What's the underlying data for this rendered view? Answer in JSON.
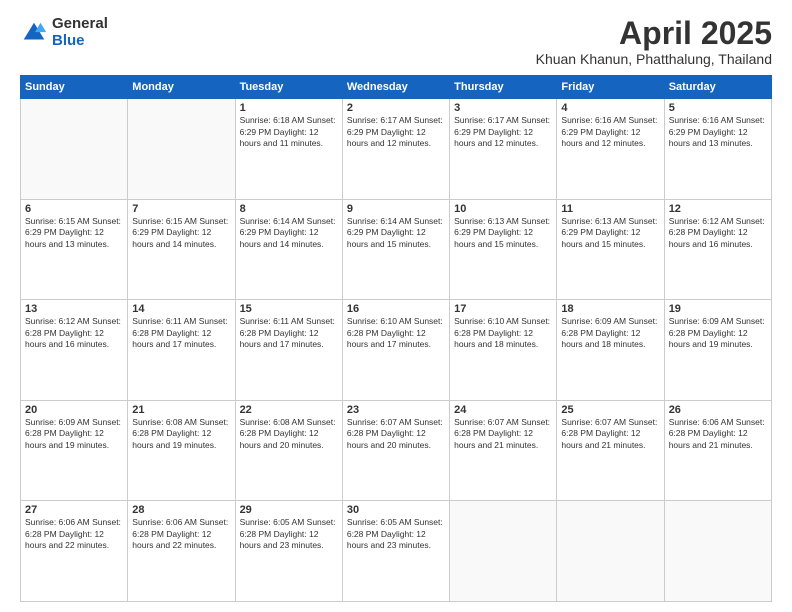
{
  "logo": {
    "general": "General",
    "blue": "Blue"
  },
  "header": {
    "month": "April 2025",
    "location": "Khuan Khanun, Phatthalung, Thailand"
  },
  "weekdays": [
    "Sunday",
    "Monday",
    "Tuesday",
    "Wednesday",
    "Thursday",
    "Friday",
    "Saturday"
  ],
  "weeks": [
    [
      {
        "day": "",
        "info": ""
      },
      {
        "day": "",
        "info": ""
      },
      {
        "day": "1",
        "info": "Sunrise: 6:18 AM\nSunset: 6:29 PM\nDaylight: 12 hours\nand 11 minutes."
      },
      {
        "day": "2",
        "info": "Sunrise: 6:17 AM\nSunset: 6:29 PM\nDaylight: 12 hours\nand 12 minutes."
      },
      {
        "day": "3",
        "info": "Sunrise: 6:17 AM\nSunset: 6:29 PM\nDaylight: 12 hours\nand 12 minutes."
      },
      {
        "day": "4",
        "info": "Sunrise: 6:16 AM\nSunset: 6:29 PM\nDaylight: 12 hours\nand 12 minutes."
      },
      {
        "day": "5",
        "info": "Sunrise: 6:16 AM\nSunset: 6:29 PM\nDaylight: 12 hours\nand 13 minutes."
      }
    ],
    [
      {
        "day": "6",
        "info": "Sunrise: 6:15 AM\nSunset: 6:29 PM\nDaylight: 12 hours\nand 13 minutes."
      },
      {
        "day": "7",
        "info": "Sunrise: 6:15 AM\nSunset: 6:29 PM\nDaylight: 12 hours\nand 14 minutes."
      },
      {
        "day": "8",
        "info": "Sunrise: 6:14 AM\nSunset: 6:29 PM\nDaylight: 12 hours\nand 14 minutes."
      },
      {
        "day": "9",
        "info": "Sunrise: 6:14 AM\nSunset: 6:29 PM\nDaylight: 12 hours\nand 15 minutes."
      },
      {
        "day": "10",
        "info": "Sunrise: 6:13 AM\nSunset: 6:29 PM\nDaylight: 12 hours\nand 15 minutes."
      },
      {
        "day": "11",
        "info": "Sunrise: 6:13 AM\nSunset: 6:29 PM\nDaylight: 12 hours\nand 15 minutes."
      },
      {
        "day": "12",
        "info": "Sunrise: 6:12 AM\nSunset: 6:28 PM\nDaylight: 12 hours\nand 16 minutes."
      }
    ],
    [
      {
        "day": "13",
        "info": "Sunrise: 6:12 AM\nSunset: 6:28 PM\nDaylight: 12 hours\nand 16 minutes."
      },
      {
        "day": "14",
        "info": "Sunrise: 6:11 AM\nSunset: 6:28 PM\nDaylight: 12 hours\nand 17 minutes."
      },
      {
        "day": "15",
        "info": "Sunrise: 6:11 AM\nSunset: 6:28 PM\nDaylight: 12 hours\nand 17 minutes."
      },
      {
        "day": "16",
        "info": "Sunrise: 6:10 AM\nSunset: 6:28 PM\nDaylight: 12 hours\nand 17 minutes."
      },
      {
        "day": "17",
        "info": "Sunrise: 6:10 AM\nSunset: 6:28 PM\nDaylight: 12 hours\nand 18 minutes."
      },
      {
        "day": "18",
        "info": "Sunrise: 6:09 AM\nSunset: 6:28 PM\nDaylight: 12 hours\nand 18 minutes."
      },
      {
        "day": "19",
        "info": "Sunrise: 6:09 AM\nSunset: 6:28 PM\nDaylight: 12 hours\nand 19 minutes."
      }
    ],
    [
      {
        "day": "20",
        "info": "Sunrise: 6:09 AM\nSunset: 6:28 PM\nDaylight: 12 hours\nand 19 minutes."
      },
      {
        "day": "21",
        "info": "Sunrise: 6:08 AM\nSunset: 6:28 PM\nDaylight: 12 hours\nand 19 minutes."
      },
      {
        "day": "22",
        "info": "Sunrise: 6:08 AM\nSunset: 6:28 PM\nDaylight: 12 hours\nand 20 minutes."
      },
      {
        "day": "23",
        "info": "Sunrise: 6:07 AM\nSunset: 6:28 PM\nDaylight: 12 hours\nand 20 minutes."
      },
      {
        "day": "24",
        "info": "Sunrise: 6:07 AM\nSunset: 6:28 PM\nDaylight: 12 hours\nand 21 minutes."
      },
      {
        "day": "25",
        "info": "Sunrise: 6:07 AM\nSunset: 6:28 PM\nDaylight: 12 hours\nand 21 minutes."
      },
      {
        "day": "26",
        "info": "Sunrise: 6:06 AM\nSunset: 6:28 PM\nDaylight: 12 hours\nand 21 minutes."
      }
    ],
    [
      {
        "day": "27",
        "info": "Sunrise: 6:06 AM\nSunset: 6:28 PM\nDaylight: 12 hours\nand 22 minutes."
      },
      {
        "day": "28",
        "info": "Sunrise: 6:06 AM\nSunset: 6:28 PM\nDaylight: 12 hours\nand 22 minutes."
      },
      {
        "day": "29",
        "info": "Sunrise: 6:05 AM\nSunset: 6:28 PM\nDaylight: 12 hours\nand 23 minutes."
      },
      {
        "day": "30",
        "info": "Sunrise: 6:05 AM\nSunset: 6:28 PM\nDaylight: 12 hours\nand 23 minutes."
      },
      {
        "day": "",
        "info": ""
      },
      {
        "day": "",
        "info": ""
      },
      {
        "day": "",
        "info": ""
      }
    ]
  ]
}
